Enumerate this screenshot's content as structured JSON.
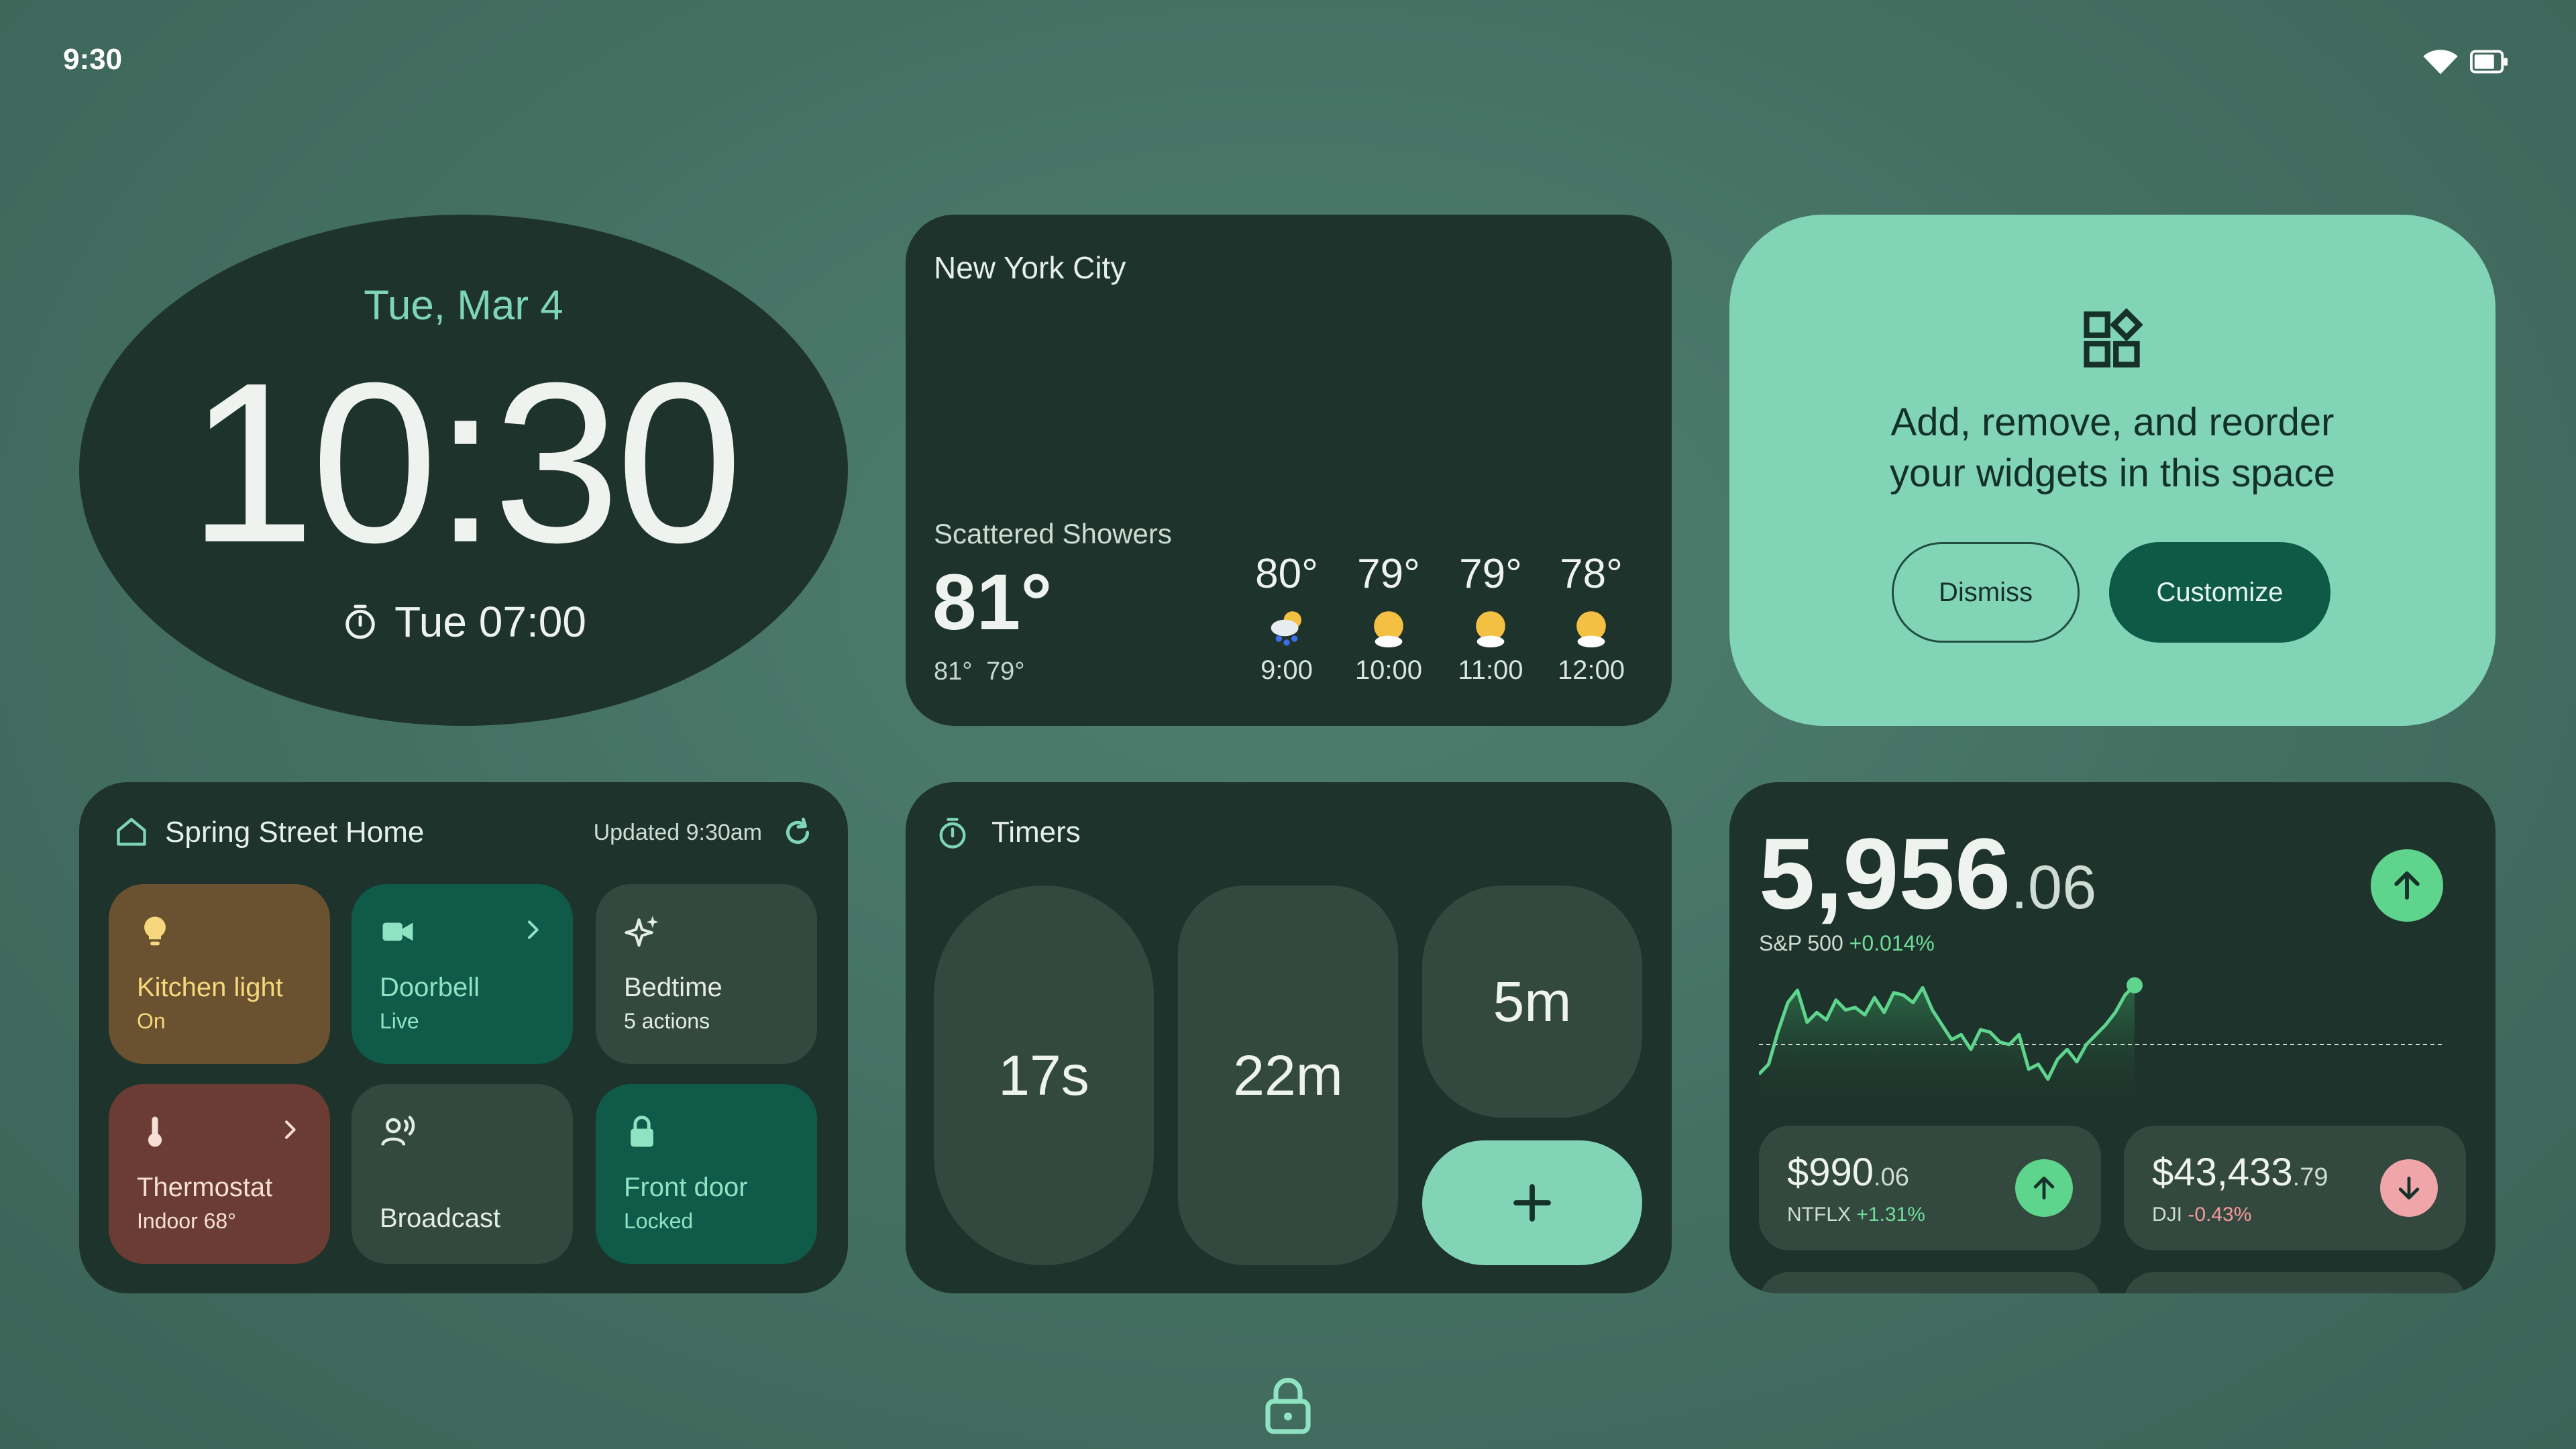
{
  "status_bar": {
    "time": "9:30",
    "icons": [
      "wifi-icon",
      "battery-icon"
    ]
  },
  "clock": {
    "date": "Tue, Mar 4",
    "time": "10:30",
    "alarm": "Tue 07:00",
    "alarm_icon": "timer-icon"
  },
  "weather": {
    "city": "New York City",
    "condition": "Scattered Showers",
    "current_temp": "81°",
    "high": "81°",
    "low": "79°",
    "hourly": [
      {
        "temp": "80°",
        "time": "9:00",
        "icon": "rain-cloud-icon"
      },
      {
        "temp": "79°",
        "time": "10:00",
        "icon": "partly-sunny-icon"
      },
      {
        "temp": "79°",
        "time": "11:00",
        "icon": "partly-sunny-icon"
      },
      {
        "temp": "78°",
        "time": "12:00",
        "icon": "partly-sunny-icon"
      }
    ]
  },
  "promo": {
    "icon": "widgets-icon",
    "text_line1": "Add, remove, and reorder",
    "text_line2": "your widgets in this space",
    "dismiss_label": "Dismiss",
    "customize_label": "Customize",
    "accent": "#82d4b7"
  },
  "home": {
    "title": "Spring Street Home",
    "updated": "Updated 9:30am",
    "tiles": [
      {
        "name": "Kitchen light",
        "sub": "On",
        "icon": "lightbulb-icon"
      },
      {
        "name": "Doorbell",
        "sub": "Live",
        "icon": "camera-icon"
      },
      {
        "name": "Bedtime",
        "sub": "5 actions",
        "icon": "sparkle-icon"
      },
      {
        "name": "Thermostat",
        "sub": "Indoor 68°",
        "icon": "thermometer-icon"
      },
      {
        "name": "Broadcast",
        "sub": "",
        "icon": "broadcast-icon"
      },
      {
        "name": "Front door",
        "sub": "Locked",
        "icon": "lock-icon"
      }
    ]
  },
  "timers": {
    "title": "Timers",
    "items": [
      "17s",
      "22m",
      "5m"
    ],
    "add_icon": "plus-icon"
  },
  "stocks": {
    "main": {
      "value_int": "5,956",
      "value_dec": ".06",
      "name": "S&P 500",
      "change": "+0.014%",
      "direction": "up"
    },
    "minis": [
      {
        "value_int": "$990",
        "value_dec": ".06",
        "name": "NTFLX",
        "change": "+1.31%",
        "direction": "up"
      },
      {
        "value_int": "$43,433",
        "value_dec": ".79",
        "name": "DJI",
        "change": "-0.43%",
        "direction": "down"
      }
    ],
    "colors": {
      "up": "#5fd48c",
      "down": "#f0a5a9"
    }
  },
  "chart_data": {
    "type": "line",
    "series": [
      {
        "values": [
          20,
          28,
          55,
          78,
          88,
          62,
          70,
          64,
          80,
          72,
          74,
          68,
          82,
          70,
          86,
          84,
          78,
          90,
          72,
          60,
          48,
          52,
          40,
          56,
          54,
          46,
          44,
          52,
          24,
          28,
          16,
          32,
          40,
          30,
          44,
          52,
          60,
          70,
          84,
          92
        ]
      }
    ],
    "baseline": 44
  }
}
